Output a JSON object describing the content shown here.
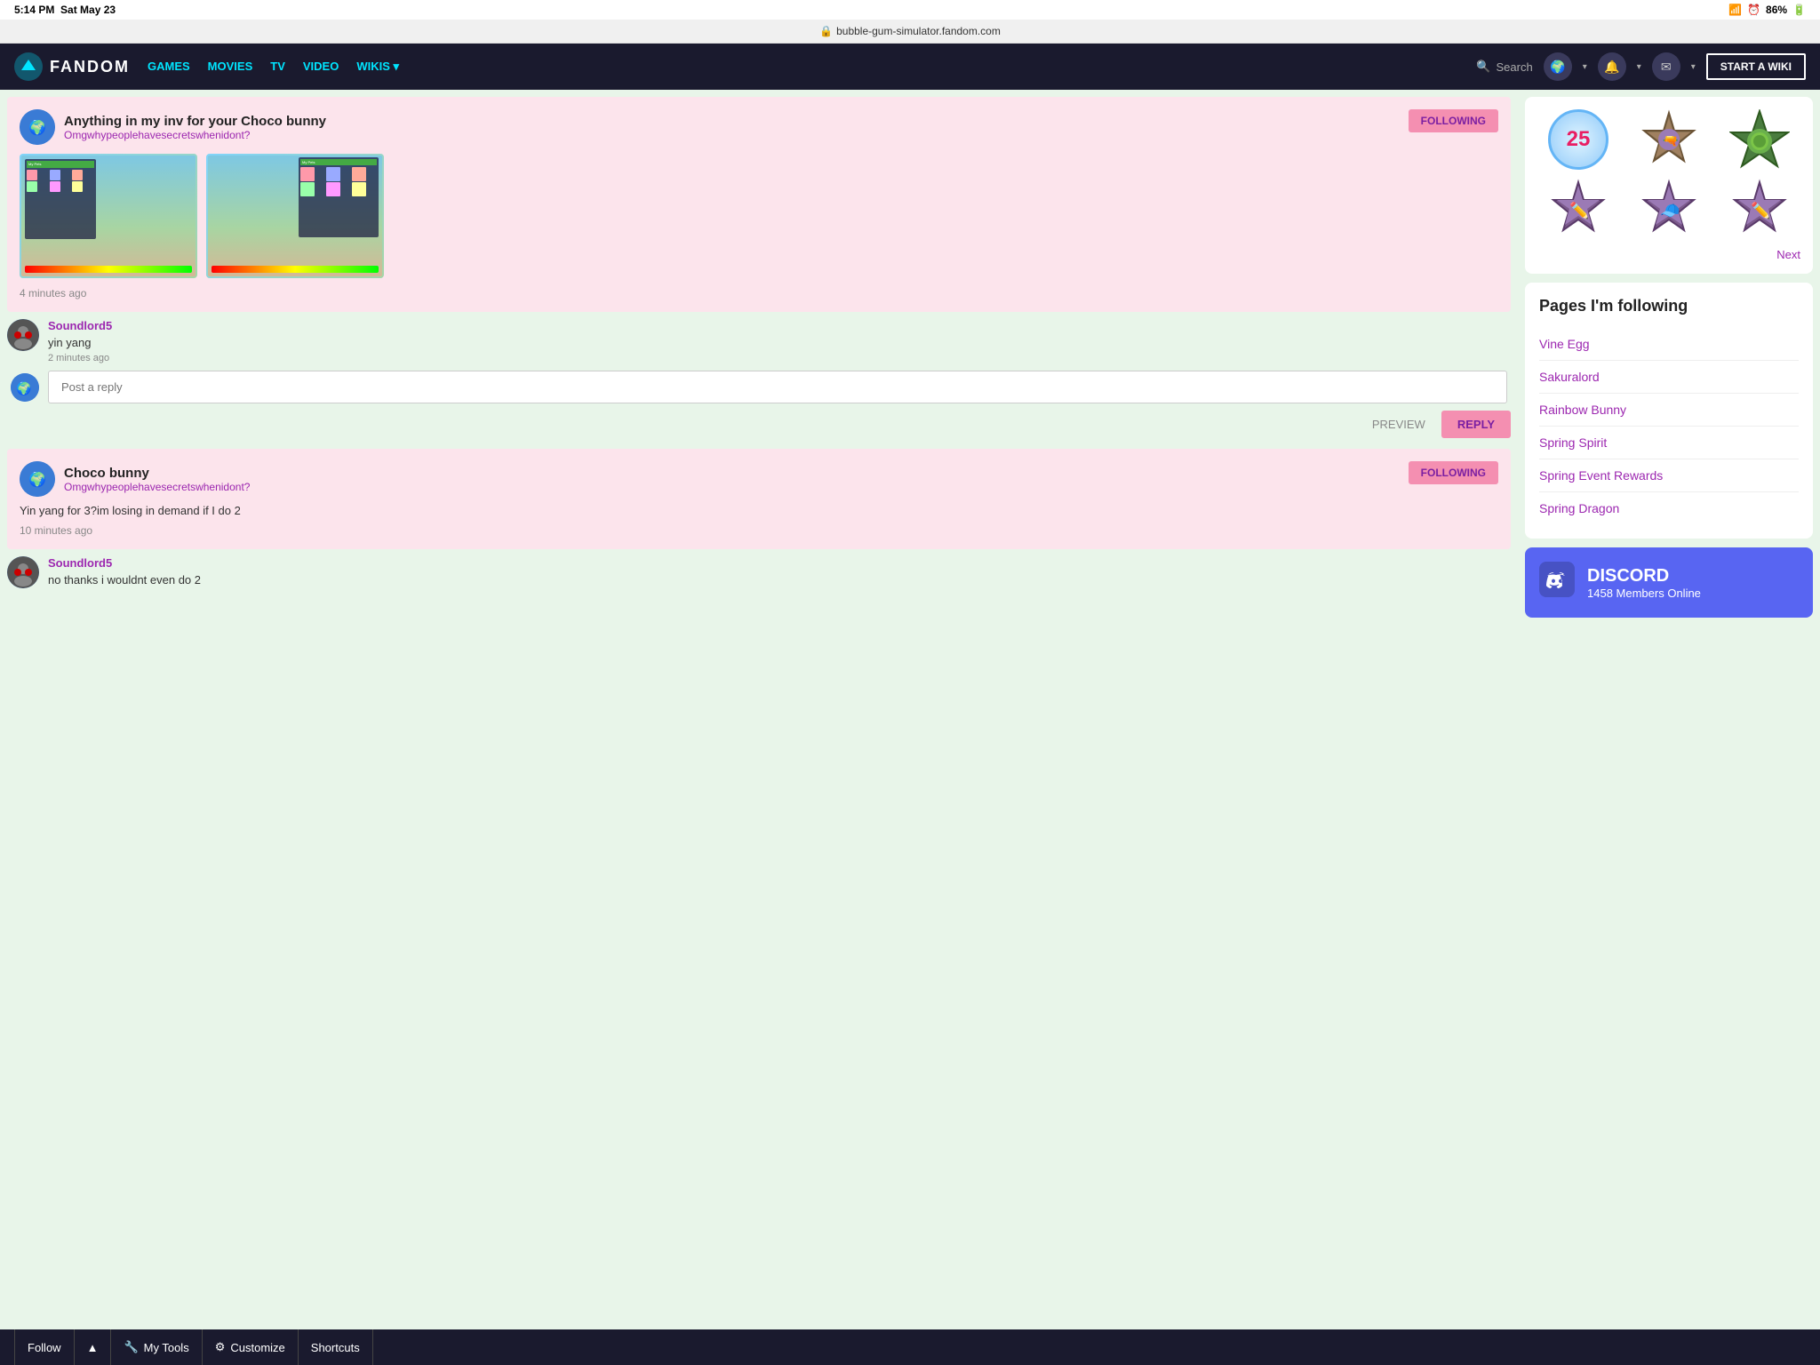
{
  "statusBar": {
    "time": "5:14 PM",
    "date": "Sat May 23",
    "battery": "86%",
    "wifiIcon": "wifi-icon",
    "alarmIcon": "alarm-icon"
  },
  "urlBar": {
    "url": "bubble-gum-simulator.fandom.com",
    "lockIcon": "lock-icon"
  },
  "nav": {
    "logoText": "FANDOM",
    "links": [
      {
        "label": "GAMES",
        "hasArrow": false
      },
      {
        "label": "MOVIES",
        "hasArrow": false
      },
      {
        "label": "TV",
        "hasArrow": false
      },
      {
        "label": "VIDEO",
        "hasArrow": false
      },
      {
        "label": "WIKIS",
        "hasArrow": true
      }
    ],
    "searchPlaceholder": "Search",
    "startWikiLabel": "START A WIKI"
  },
  "posts": [
    {
      "id": "post1",
      "title": "Anything in my inv for your Choco bunny",
      "username": "Omgwhypeoplehavesecretswhenidont?",
      "followingLabel": "FOLLOWING",
      "timeAgo": "4 minutes ago",
      "hasImages": true
    },
    {
      "id": "post2",
      "title": "Choco bunny",
      "username": "Omgwhypeoplehavesecretswhenidont?",
      "followingLabel": "FOLLOWING",
      "bodyText": "Yin yang for 3?im losing in demand if I do 2",
      "timeAgo": "10 minutes ago",
      "hasImages": false
    }
  ],
  "comment1": {
    "username": "Soundlord5",
    "text": "yin yang",
    "timeAgo": "2 minutes ago",
    "avatarAlt": "soundlord5-avatar"
  },
  "comment2": {
    "username": "Soundlord5",
    "text": "no thanks i wouldnt even do 2",
    "timeAgo": "",
    "avatarAlt": "soundlord5-avatar-2"
  },
  "replyInput": {
    "placeholder": "Post a reply",
    "previewLabel": "PREVIEW",
    "replyLabel": "REPLY"
  },
  "badges": {
    "items": [
      {
        "type": "circle-25",
        "label": "25 badge"
      },
      {
        "type": "star-brown",
        "label": "achievement badge"
      },
      {
        "type": "star-green",
        "label": "achievement badge"
      },
      {
        "type": "star-pencil",
        "label": "achievement badge"
      },
      {
        "type": "star-cap",
        "label": "achievement badge"
      },
      {
        "type": "star-pencil2",
        "label": "achievement badge"
      }
    ],
    "nextLabel": "Next"
  },
  "pagesFollowing": {
    "title": "Pages I'm following",
    "pages": [
      {
        "label": "Vine Egg"
      },
      {
        "label": "Sakuralord"
      },
      {
        "label": "Rainbow Bunny"
      },
      {
        "label": "Spring Spirit"
      },
      {
        "label": "Spring Event Rewards"
      },
      {
        "label": "Spring Dragon"
      }
    ]
  },
  "discord": {
    "membersOnline": "1458",
    "subtitle": "Members Online"
  },
  "toolbar": {
    "followLabel": "Follow",
    "myToolsLabel": "My Tools",
    "customizeLabel": "Customize",
    "shortcutsLabel": "Shortcuts"
  }
}
